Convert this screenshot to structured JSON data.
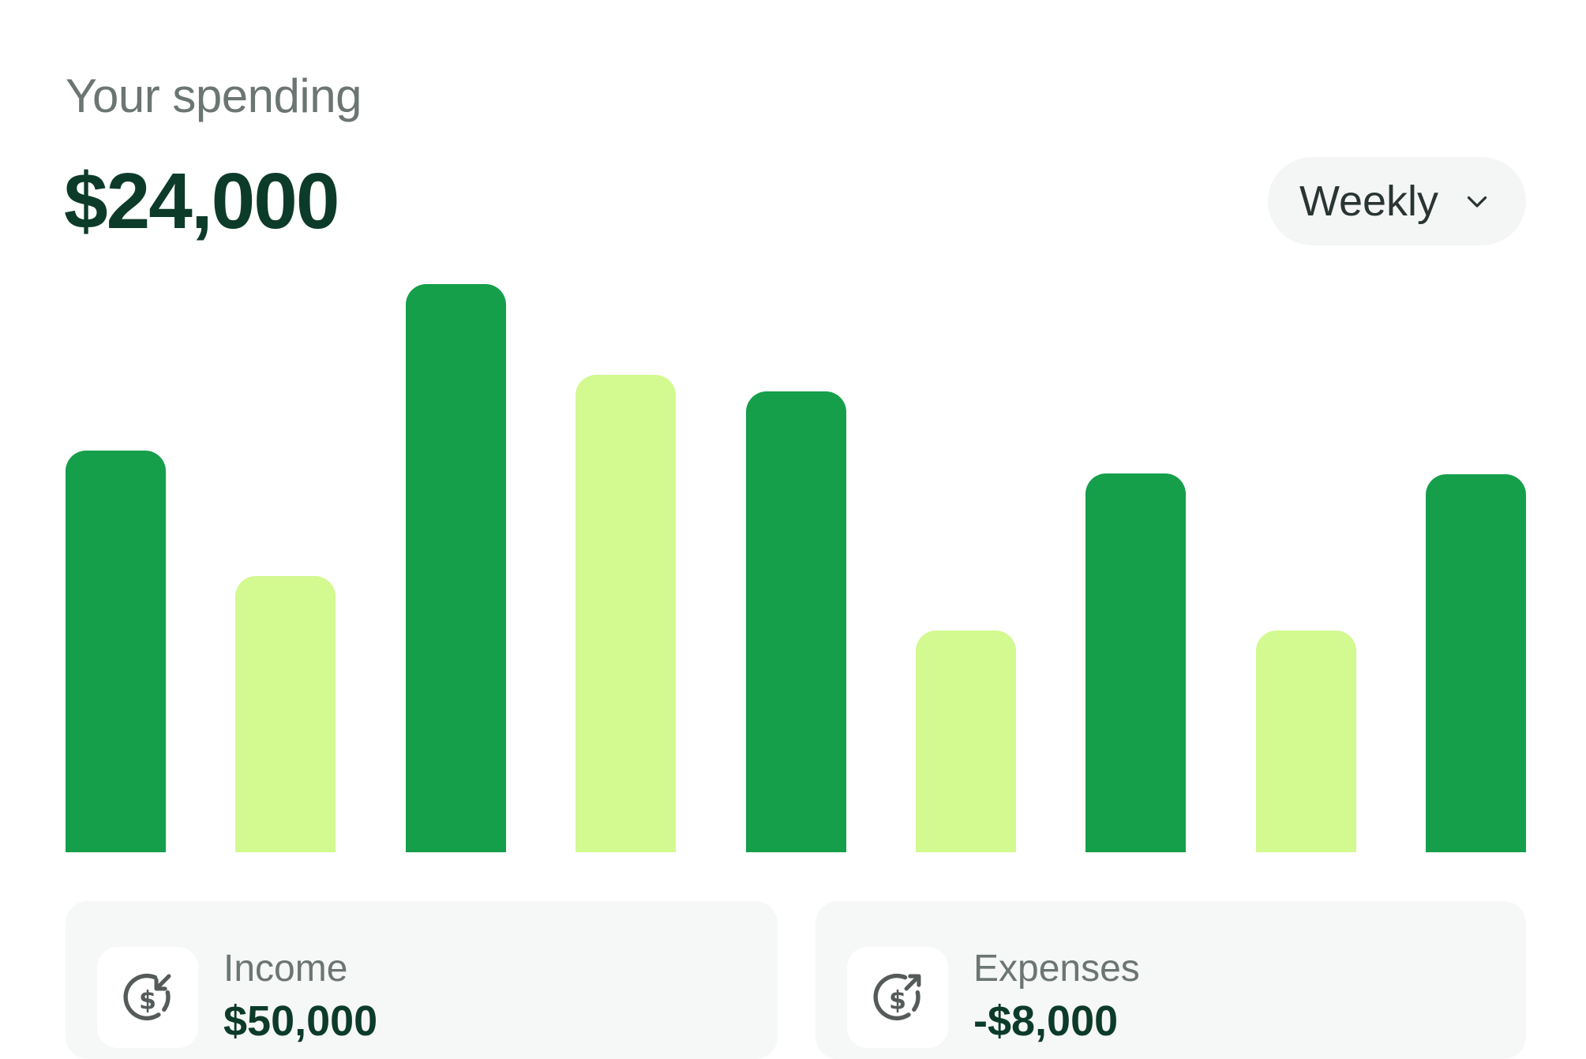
{
  "header": {
    "title": "Your spending",
    "amount": "$24,000"
  },
  "period_select": {
    "selected": "Weekly",
    "icon": "chevron-down-icon"
  },
  "chart_data": {
    "type": "bar",
    "values": [
      495,
      340,
      700,
      588,
      568,
      273,
      467,
      273,
      466
    ],
    "ylim": [
      0,
      700
    ],
    "colors": [
      "#159f4a",
      "#d3f991",
      "#159f4a",
      "#d3f991",
      "#159f4a",
      "#d3f991",
      "#159f4a",
      "#d3f991",
      "#159f4a"
    ],
    "grid": false
  },
  "summary": {
    "income": {
      "label": "Income",
      "value": "$50,000",
      "icon": "dollar-arrow-in-icon"
    },
    "expenses": {
      "label": "Expenses",
      "value": "-$8,000",
      "icon": "dollar-arrow-out-icon"
    }
  },
  "colors": {
    "bar_dark": "#159f4a",
    "bar_light": "#d3f991",
    "text_dark": "#0d3b2a",
    "text_muted": "#6b7572",
    "pill_bg": "#f4f6f6"
  }
}
